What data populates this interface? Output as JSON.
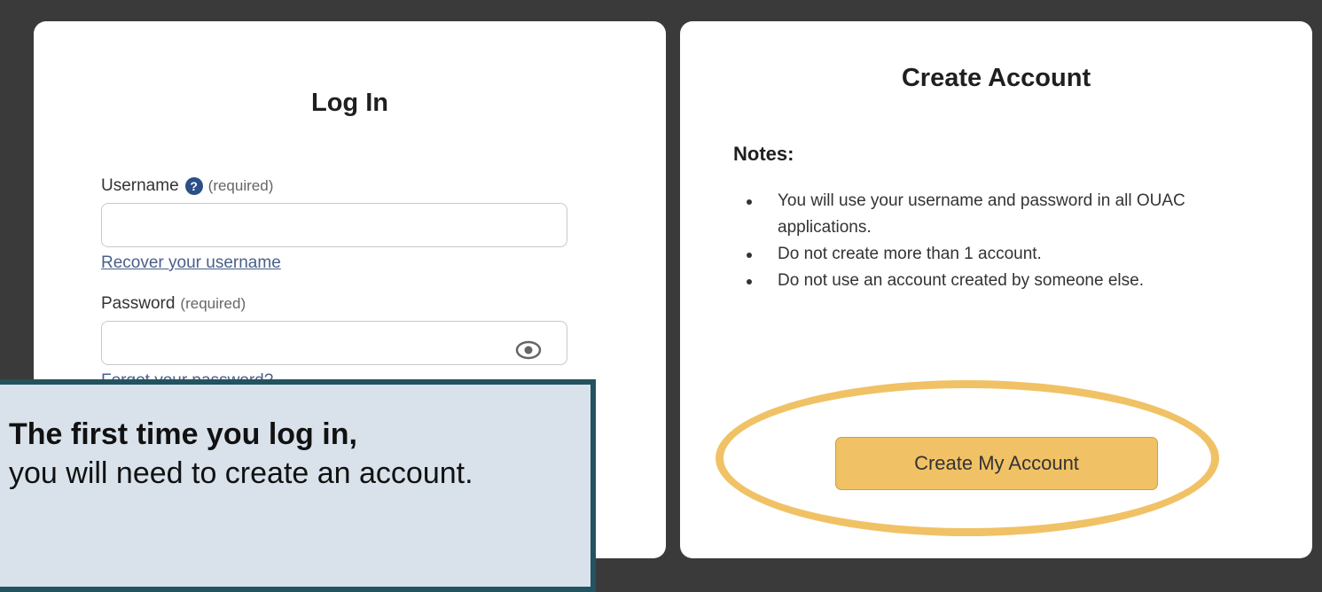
{
  "login": {
    "title": "Log In",
    "username_label": "Username",
    "username_required": "(required)",
    "username_value": "",
    "recover_username_link": "Recover your username",
    "password_label": "Password",
    "password_required": "(required)",
    "password_value": "",
    "forgot_password_link": "Forgot your password?"
  },
  "create": {
    "title": "Create Account",
    "notes_title": "Notes:",
    "notes": [
      "You will use your username and password in all OUAC applications.",
      "Do not create more than 1 account.",
      "Do not use an account created by someone else."
    ],
    "button_label": "Create My Account"
  },
  "callout": {
    "bold_text": "The first time you log in,",
    "text": "you will need to create an account."
  },
  "colors": {
    "background": "#3a3a3a",
    "accent": "#f0c265",
    "callout_border": "#23535e",
    "callout_fill": "#d9e2ea",
    "help_icon": "#2c4f86",
    "link": "#4a5f8a"
  },
  "icons": {
    "help": "question-circle-icon",
    "password_toggle": "eye-icon"
  }
}
